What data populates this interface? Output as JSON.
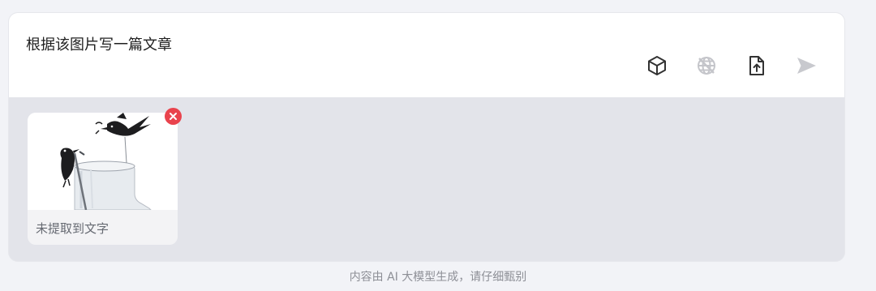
{
  "composer": {
    "prompt_text": "根据该图片写一篇文章",
    "toolbar": {
      "icons": [
        "cube-icon",
        "web-search-disabled-icon",
        "file-upload-icon",
        "send-icon"
      ],
      "send_color": "#c8c9ce",
      "icon_color": "#333333",
      "disabled_color": "#c4c5ca"
    },
    "attachments": [
      {
        "thumbnail": "crow-and-pitcher-illustration",
        "caption": "未提取到文字",
        "remove_icon": "remove-icon",
        "remove_color": "#e9434d"
      }
    ]
  },
  "footer": {
    "note": "内容由 AI 大模型生成，请仔细甄别"
  }
}
